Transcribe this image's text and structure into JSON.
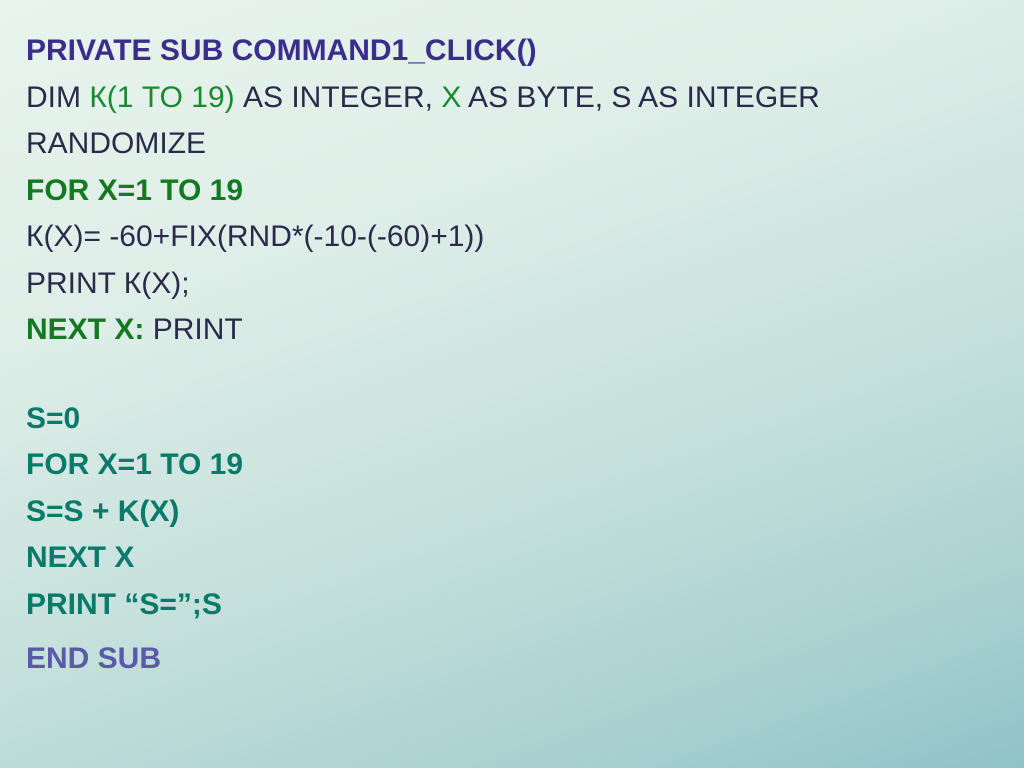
{
  "l1": {
    "a": "PRIVATE SUB COMMAND1_CLICK()"
  },
  "l2": {
    "a": "DIM ",
    "b": "К(1  TO 19)",
    "c": " AS INTEGER, ",
    "d": "X",
    "e": "  AS BYTE, S AS INTEGER"
  },
  "l3": {
    "a": "RANDOMIZE"
  },
  "l4": {
    "a": "FOR X=1 TO 19"
  },
  "l5": {
    "a": "К(X)= -60+FIX(RND*(-10-(-60)+1))"
  },
  "l6": {
    "a": "PRINT К(X);"
  },
  "l7": {
    "a": "NEXT X:",
    "b": " PRINT"
  },
  "l8": {
    "a": "S=0"
  },
  "l9": {
    "a": "FOR X=1 TO 19"
  },
  "l10": {
    "a": "S=S + K(X)"
  },
  "l11": {
    "a": "NEXT X"
  },
  "l12": {
    "a": "PRINT “S=”;S"
  },
  "l13": {
    "a": "END SUB"
  }
}
